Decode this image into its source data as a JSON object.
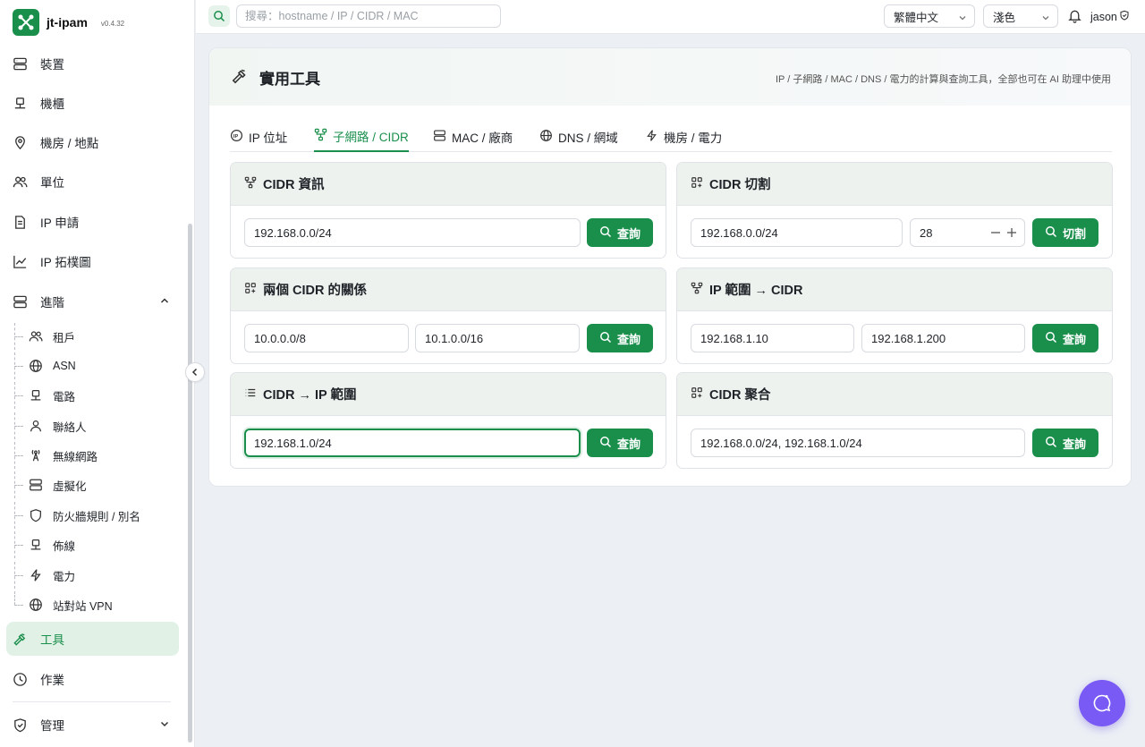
{
  "app": {
    "name": "jt-ipam",
    "version": "v0.4.32"
  },
  "sidebar": {
    "items": [
      {
        "label": "裝置",
        "icon": "server-icon"
      },
      {
        "label": "機櫃",
        "icon": "rack-icon"
      },
      {
        "label": "機房 / 地點",
        "icon": "location-icon"
      },
      {
        "label": "單位",
        "icon": "users-icon"
      },
      {
        "label": "IP 申請",
        "icon": "document-icon"
      },
      {
        "label": "IP 拓樸圖",
        "icon": "chart-line-icon"
      },
      {
        "label": "進階",
        "icon": "server-icon"
      },
      {
        "label": "工具",
        "icon": "hammer-icon"
      },
      {
        "label": "作業",
        "icon": "clock-icon"
      },
      {
        "label": "管理",
        "icon": "shield-icon"
      }
    ],
    "sub_items": [
      {
        "label": "租戶",
        "icon": "users-icon"
      },
      {
        "label": "ASN",
        "icon": "globe-icon"
      },
      {
        "label": "電路",
        "icon": "rack-icon"
      },
      {
        "label": "聯絡人",
        "icon": "user-icon"
      },
      {
        "label": "無線網路",
        "icon": "antenna-icon"
      },
      {
        "label": "虛擬化",
        "icon": "server-icon"
      },
      {
        "label": "防火牆規則 / 別名",
        "icon": "shield-icon"
      },
      {
        "label": "佈線",
        "icon": "rack-icon"
      },
      {
        "label": "電力",
        "icon": "bolt-icon"
      },
      {
        "label": "站對站 VPN",
        "icon": "globe-icon"
      }
    ]
  },
  "topbar": {
    "search_placeholder": "搜尋：hostname / IP / CIDR / MAC",
    "language": "繁體中文",
    "theme": "淺色",
    "user": "jason"
  },
  "page": {
    "title": "實用工具",
    "description": "IP / 子網路 / MAC / DNS / 電力的計算與查詢工具，全部也可在 AI 助理中使用",
    "tabs": [
      {
        "label": "IP 位址",
        "icon": "ip-icon"
      },
      {
        "label": "子網路 / CIDR",
        "icon": "network-icon",
        "active": true
      },
      {
        "label": "MAC / 廠商",
        "icon": "server-icon"
      },
      {
        "label": "DNS / 網域",
        "icon": "globe-icon"
      },
      {
        "label": "機房 / 電力",
        "icon": "bolt-icon"
      }
    ]
  },
  "tools": {
    "cidr_info": {
      "title": "CIDR 資訊",
      "input": "192.168.0.0/24",
      "button": "查詢"
    },
    "cidr_split": {
      "title": "CIDR 切割",
      "input": "192.168.0.0/24",
      "prefix": "28",
      "button": "切割"
    },
    "cidr_relation": {
      "title": "兩個 CIDR 的關係",
      "input_a": "10.0.0.0/8",
      "input_b": "10.1.0.0/16",
      "button": "查詢"
    },
    "range_to_cidr": {
      "title": "IP 範圍 → CIDR",
      "input_a": "192.168.1.10",
      "input_b": "192.168.1.200",
      "button": "查詢"
    },
    "cidr_to_range": {
      "title": "CIDR → IP 範圍",
      "input": "192.168.1.0/24",
      "button": "查詢"
    },
    "cidr_aggregate": {
      "title": "CIDR 聚合",
      "input": "192.168.0.0/24, 192.168.1.0/24",
      "button": "查詢"
    }
  },
  "colors": {
    "accent": "#1a8f4c",
    "active_bg": "#e2f1e6",
    "fab": "#7a5af5"
  }
}
